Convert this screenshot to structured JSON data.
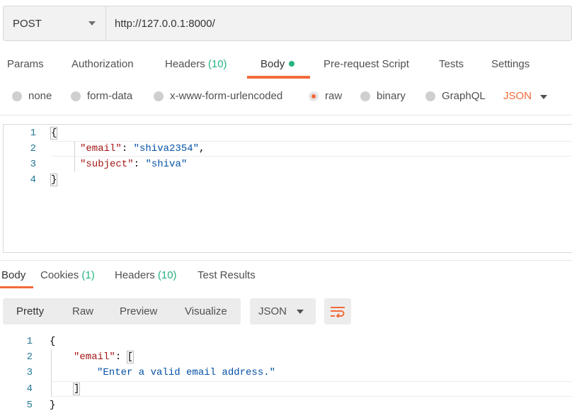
{
  "request": {
    "method": "POST",
    "url": "http://127.0.0.1:8000/"
  },
  "request_tabs": [
    {
      "label": "Params"
    },
    {
      "label": "Authorization"
    },
    {
      "label": "Headers",
      "count": "(10)"
    },
    {
      "label": "Body"
    },
    {
      "label": "Pre-request Script"
    },
    {
      "label": "Tests"
    },
    {
      "label": "Settings"
    }
  ],
  "body_types": [
    "none",
    "form-data",
    "x-www-form-urlencoded",
    "raw",
    "binary",
    "GraphQL"
  ],
  "body_selected": "raw",
  "body_format": "JSON",
  "request_code": {
    "line_numbers": [
      "1",
      "2",
      "3",
      "4"
    ],
    "open": "{",
    "email_key": "\"email\"",
    "email_value": "\"shiva2354\"",
    "subject_key": "\"subject\"",
    "subject_value": "\"shiva\"",
    "close": "}"
  },
  "response_tabs": [
    {
      "label": "Body"
    },
    {
      "label": "Cookies",
      "count": "(1)"
    },
    {
      "label": "Headers",
      "count": "(10)"
    },
    {
      "label": "Test Results"
    }
  ],
  "response_views": [
    "Pretty",
    "Raw",
    "Preview",
    "Visualize"
  ],
  "response_format": "JSON",
  "response_code": {
    "line_numbers": [
      "1",
      "2",
      "3",
      "4",
      "5"
    ],
    "open": "{",
    "email_key": "\"email\"",
    "array_open": "[",
    "message": "\"Enter a valid email address.\"",
    "array_close": "]",
    "close": "}"
  },
  "colors": {
    "accent": "#f26b3a",
    "count_green": "#26b47f",
    "json_key": "#a31515",
    "json_string": "#0451a5",
    "line_number": "#237893"
  }
}
